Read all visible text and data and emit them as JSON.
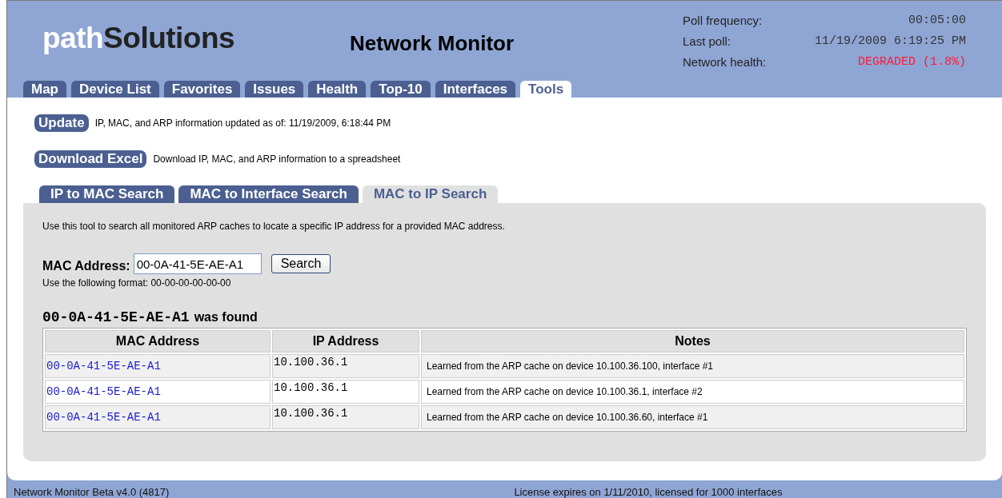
{
  "logo": {
    "light": "path",
    "dark": "Solutions"
  },
  "app_title": "Network Monitor",
  "poll": [
    {
      "label": "Poll frequency:",
      "value": "00:05:00",
      "kind": "normal"
    },
    {
      "label": "Last poll:",
      "value": "11/19/2009 6:19:25 PM",
      "kind": "normal"
    },
    {
      "label": "Network health:",
      "value": "DEGRADED (1.8%)",
      "kind": "alert"
    }
  ],
  "tabs": [
    {
      "label": "Map",
      "selected": false
    },
    {
      "label": "Device List",
      "selected": false
    },
    {
      "label": "Favorites",
      "selected": false
    },
    {
      "label": "Issues",
      "selected": false
    },
    {
      "label": "Health",
      "selected": false
    },
    {
      "label": "Top-10",
      "selected": false
    },
    {
      "label": "Interfaces",
      "selected": false
    },
    {
      "label": "Tools",
      "selected": true
    }
  ],
  "actions": [
    {
      "button": "Update",
      "text": "IP, MAC, and ARP information updated as of: 11/19/2009, 6:18:44 PM"
    },
    {
      "button": "Download Excel",
      "text": "Download IP, MAC, and ARP information to a spreadsheet"
    }
  ],
  "subtabs": [
    {
      "label": "IP to MAC Search",
      "selected": false
    },
    {
      "label": "MAC to Interface Search",
      "selected": false
    },
    {
      "label": "MAC to IP Search",
      "selected": true
    }
  ],
  "description": "Use this tool to search all monitored ARP caches to locate a specific IP address for a provided MAC address.",
  "form": {
    "label": "MAC Address:",
    "value": "00-0A-41-5E-AE-A1",
    "button": "Search",
    "hint": "Use the following format: 00-00-00-00-00-00"
  },
  "result": {
    "mac": "00-0A-41-5E-AE-A1",
    "text": "was found"
  },
  "table": {
    "columns": [
      "MAC Address",
      "IP Address",
      "Notes"
    ],
    "rows": [
      [
        "00-0A-41-5E-AE-A1",
        "10.100.36.1",
        "Learned from the ARP cache on device 10.100.36.100, interface #1"
      ],
      [
        "00-0A-41-5E-AE-A1",
        "10.100.36.1",
        "Learned from the ARP cache on device 10.100.36.1, interface #2"
      ],
      [
        "00-0A-41-5E-AE-A1",
        "10.100.36.1",
        "Learned from the ARP cache on device 10.100.36.60, interface #1"
      ]
    ]
  },
  "status_bar": {
    "left": "Network Monitor Beta v4.0 (4817)",
    "right": "License expires on 1/11/2010, licensed for 1000 interfaces"
  }
}
